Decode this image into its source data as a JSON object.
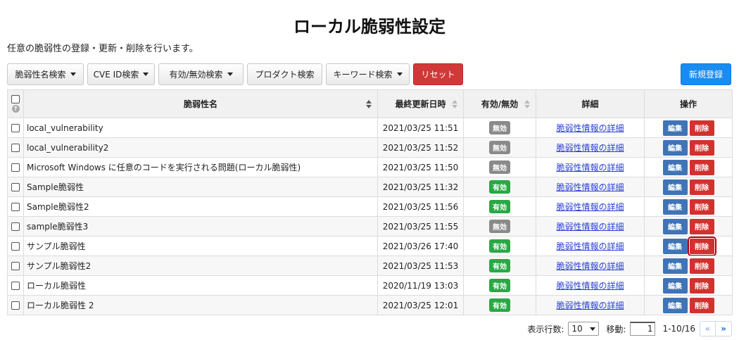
{
  "page": {
    "title": "ローカル脆弱性設定",
    "description": "任意の脆弱性の登録・更新・削除を行います。"
  },
  "toolbar": {
    "search_by_name": "脆弱性名検索",
    "search_by_cve": "CVE ID検索",
    "search_by_enabled": "有効/無効検索",
    "product_search": "プロダクト検索",
    "keyword_search": "キーワード検索",
    "reset": "リセット",
    "new_register": "新規登録"
  },
  "table": {
    "columns": {
      "help": "?",
      "name": "脆弱性名",
      "updated": "最終更新日時",
      "enabled": "有効/無効",
      "detail": "詳細",
      "actions": "操作"
    },
    "rows": [
      {
        "name": "local_vulnerability",
        "updated": "2021/03/25 11:51",
        "status": "無効",
        "status_type": "off",
        "detail": "脆弱性情報の詳細",
        "edit": "編集",
        "delete": "削除"
      },
      {
        "name": "local_vulnerability2",
        "updated": "2021/03/25 11:52",
        "status": "無効",
        "status_type": "off",
        "detail": "脆弱性情報の詳細",
        "edit": "編集",
        "delete": "削除"
      },
      {
        "name": "Microsoft Windows に任意のコードを実行される問題(ローカル脆弱性)",
        "updated": "2021/03/25 11:50",
        "status": "無効",
        "status_type": "off",
        "detail": "脆弱性情報の詳細",
        "edit": "編集",
        "delete": "削除"
      },
      {
        "name": "Sample脆弱性",
        "updated": "2021/03/25 11:32",
        "status": "有効",
        "status_type": "on",
        "detail": "脆弱性情報の詳細",
        "edit": "編集",
        "delete": "削除"
      },
      {
        "name": "Sample脆弱性2",
        "updated": "2021/03/25 11:56",
        "status": "有効",
        "status_type": "on",
        "detail": "脆弱性情報の詳細",
        "edit": "編集",
        "delete": "削除"
      },
      {
        "name": "sample脆弱性3",
        "updated": "2021/03/25 11:55",
        "status": "無効",
        "status_type": "off",
        "detail": "脆弱性情報の詳細",
        "edit": "編集",
        "delete": "削除"
      },
      {
        "name": "サンプル脆弱性",
        "updated": "2021/03/26 17:40",
        "status": "有効",
        "status_type": "on",
        "detail": "脆弱性情報の詳細",
        "edit": "編集",
        "delete": "削除",
        "focused": true
      },
      {
        "name": "サンプル脆弱性2",
        "updated": "2021/03/25 11:53",
        "status": "有効",
        "status_type": "on",
        "detail": "脆弱性情報の詳細",
        "edit": "編集",
        "delete": "削除"
      },
      {
        "name": "ローカル脆弱性",
        "updated": "2020/11/19 13:03",
        "status": "有効",
        "status_type": "on",
        "detail": "脆弱性情報の詳細",
        "edit": "編集",
        "delete": "削除"
      },
      {
        "name": "ローカル脆弱性 2",
        "updated": "2021/03/25 12:01",
        "status": "有効",
        "status_type": "on",
        "detail": "脆弱性情報の詳細",
        "edit": "編集",
        "delete": "削除"
      }
    ]
  },
  "pager": {
    "rows_label": "表示行数:",
    "rows_value": "10",
    "move_label": "移動:",
    "page_value": "1",
    "range": "1-10/16",
    "prev_icon": "«",
    "next_icon": "»"
  },
  "colors": {
    "reset": "#d13838",
    "new": "#1a8cf0",
    "badge_on": "#2aa845",
    "badge_off": "#8a8a8a",
    "edit": "#3f74b7",
    "delete": "#d1322f",
    "link": "#2a3fd4"
  }
}
